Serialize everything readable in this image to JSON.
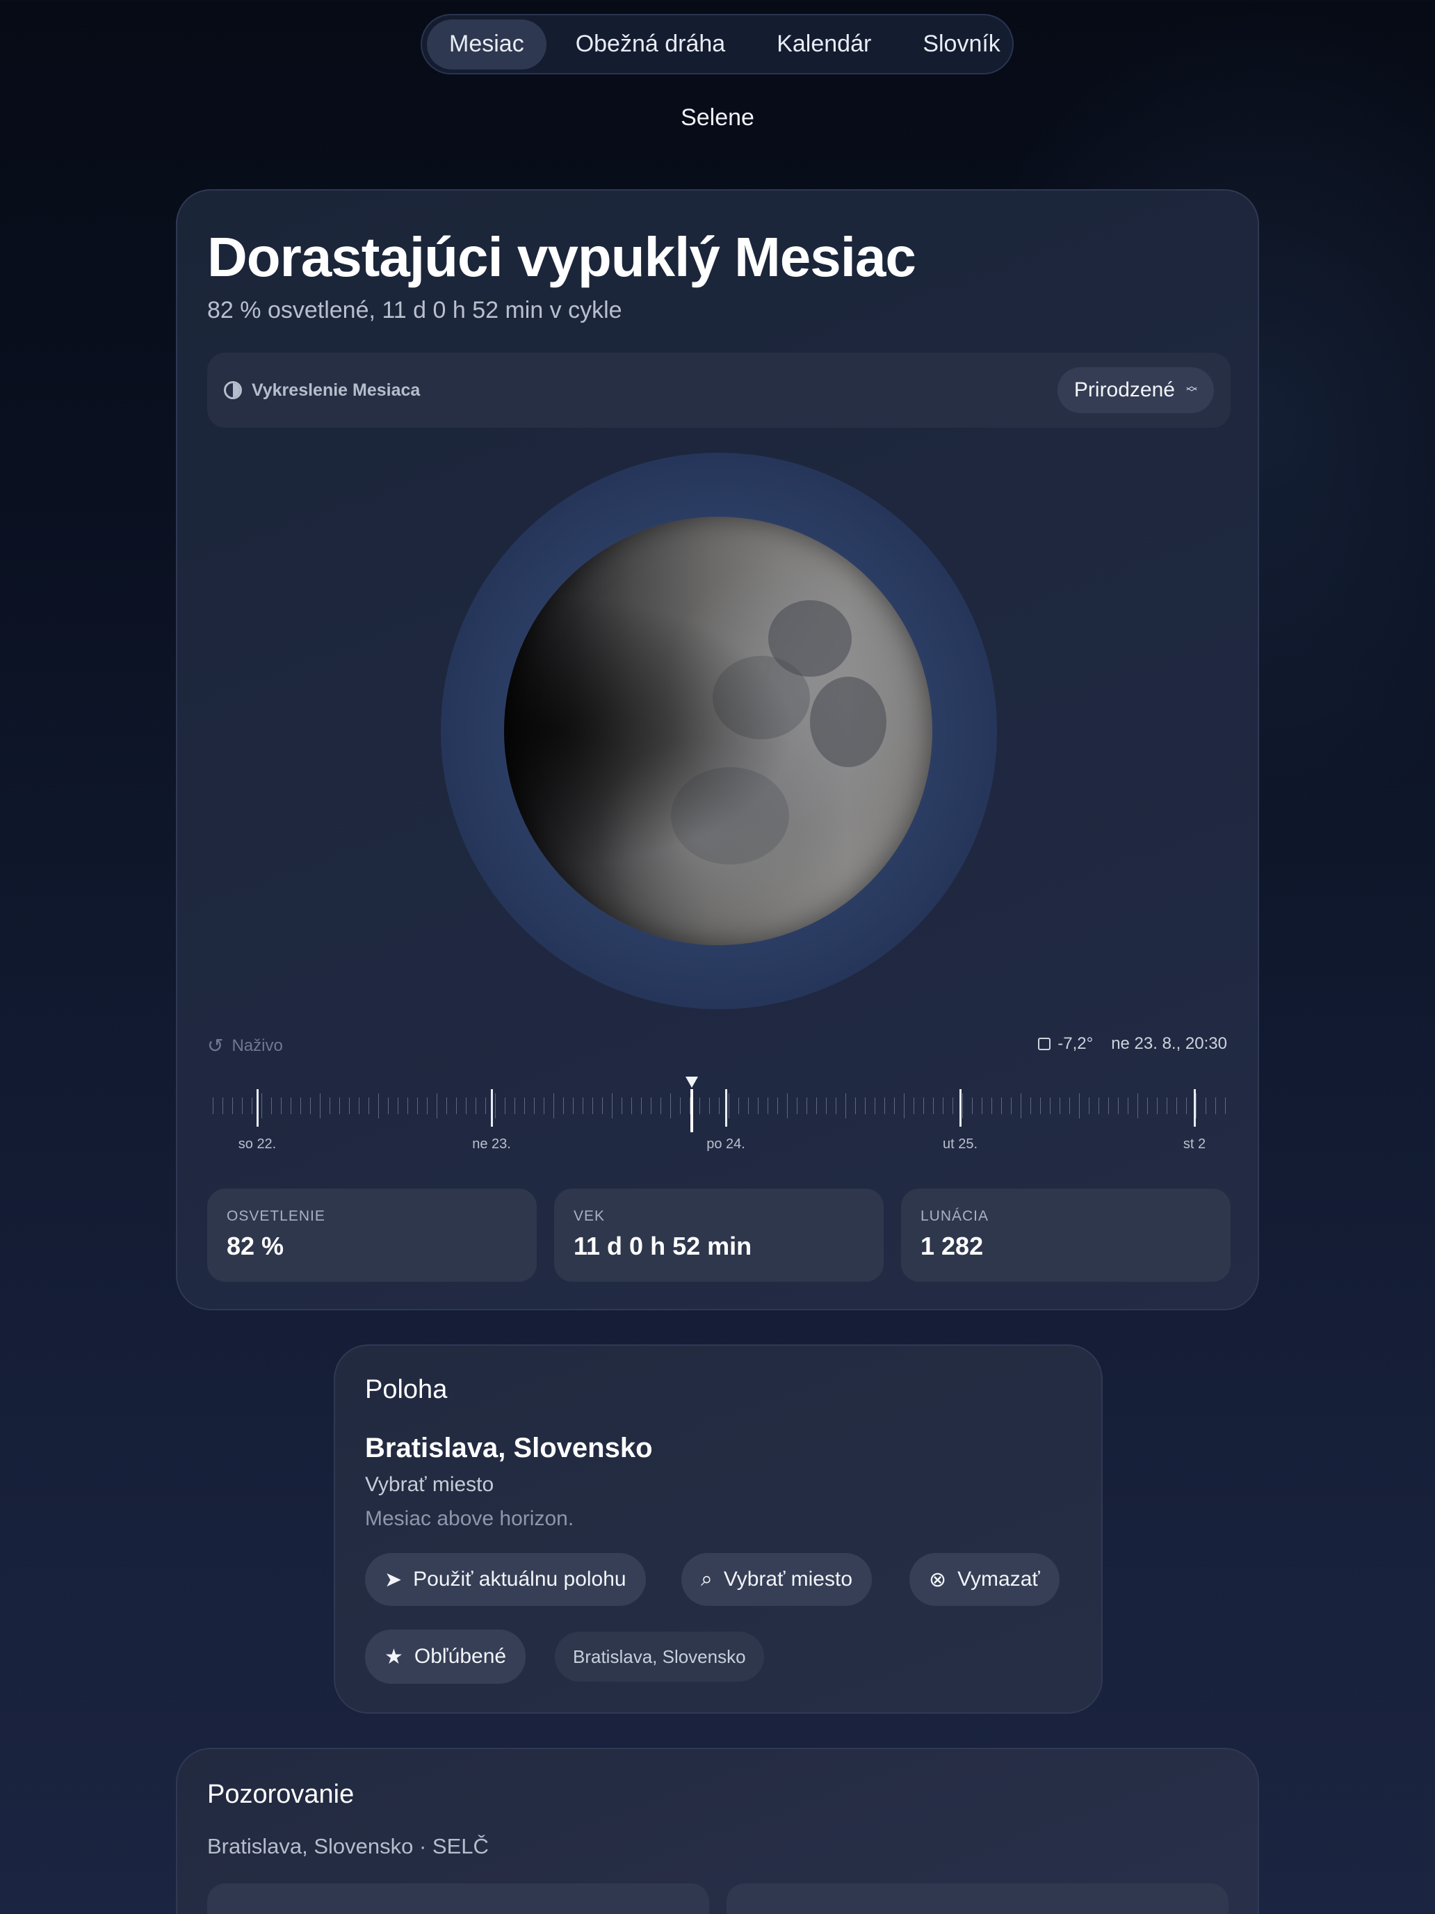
{
  "nav": {
    "tabs": [
      {
        "label": "Mesiac",
        "active": true
      },
      {
        "label": "Obežná dráha",
        "active": false
      },
      {
        "label": "Kalendár",
        "active": false
      },
      {
        "label": "Slovník",
        "active": false
      }
    ]
  },
  "app_title": "Selene",
  "moon_card": {
    "phase_title": "Dorastajúci vypuklý Mesiac",
    "phase_subtitle": "82 % osvetlené, 11 d 0 h 52 min v cykle",
    "render_label": "Vykreslenie Mesiaca",
    "render_icon": "half-circle-icon",
    "render_mode": "Prirodzené",
    "illumination_fraction": 0.82,
    "live_label": "Naživo",
    "rotation": "-7,2°",
    "datetime": "ne 23. 8., 20:30",
    "timeline_labels": [
      "so 22.",
      "ne 23.",
      "po 24.",
      "ut 25.",
      "st 2"
    ],
    "stats": [
      {
        "label": "OSVETLENIE",
        "value": "82 %"
      },
      {
        "label": "VEK",
        "value": "11 d 0 h 52 min"
      },
      {
        "label": "LUNÁCIA",
        "value": "1 282"
      }
    ]
  },
  "location": {
    "heading": "Poloha",
    "city": "Bratislava, Slovensko",
    "pick_label": "Vybrať miesto",
    "status": "Mesiac above horizon.",
    "buttons": {
      "current": "Použiť aktuálnu polohu",
      "pick": "Vybrať miesto",
      "clear": "Vymazať",
      "favorites": "Obľúbené"
    },
    "favorite_chip": "Bratislava, Slovensko"
  },
  "observation": {
    "heading": "Pozorovanie",
    "subtitle": "Bratislava, Slovensko · SELČ"
  },
  "colors": {
    "background": "#0a1020",
    "card": "#1f2840",
    "accent_active_tab": "#2e3850",
    "halo": "#2f4168"
  }
}
